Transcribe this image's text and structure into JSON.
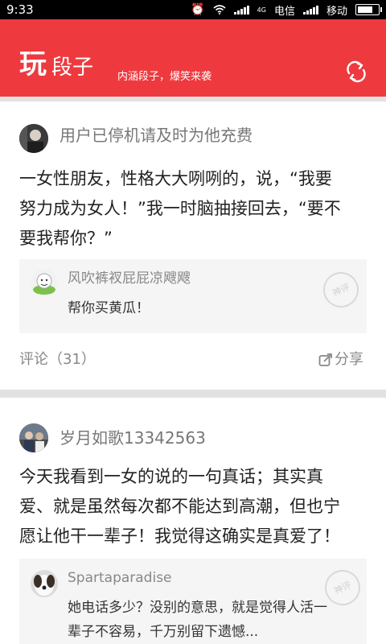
{
  "status_bar": {
    "time": "9:33",
    "network_4g": "4G",
    "carrier1": "电信",
    "carrier2": "移动"
  },
  "header": {
    "logo_main": "玩",
    "logo_sub": "段子",
    "slogan": "内涵段子，爆笑来袭",
    "accent": "#ee3a3f"
  },
  "posts": [
    {
      "username": "用户已停机请及时为他充费",
      "text_line1": "一女性朋友，性格大大咧咧的，说，“我要",
      "text_line2": "努力成为女人！”我一时脑抽接回去，“要不",
      "text_line3": "要我帮你？”",
      "top_comment": {
        "name": "风吹裤衩屁屁凉飕飕",
        "text": "帮你买黄瓜！",
        "stamp": "神评"
      },
      "comment_label": "评论（31）",
      "share_label": "分享"
    },
    {
      "username": "岁月如歌13342563",
      "text_line1": "今天我看到一女的说的一句真话；其实真",
      "text_line2": "爱、就是虽然每次都不能达到高潮，但也宁",
      "text_line3": "愿让他干一辈子！我觉得这确实是真爱了！",
      "top_comment": {
        "name": "Spartaparadise",
        "text_line1": "她电话多少？没别的意思，就是觉得人活一",
        "text_line2": "辈子不容易，千万别留下遗憾...",
        "stamp": "神评"
      }
    }
  ]
}
